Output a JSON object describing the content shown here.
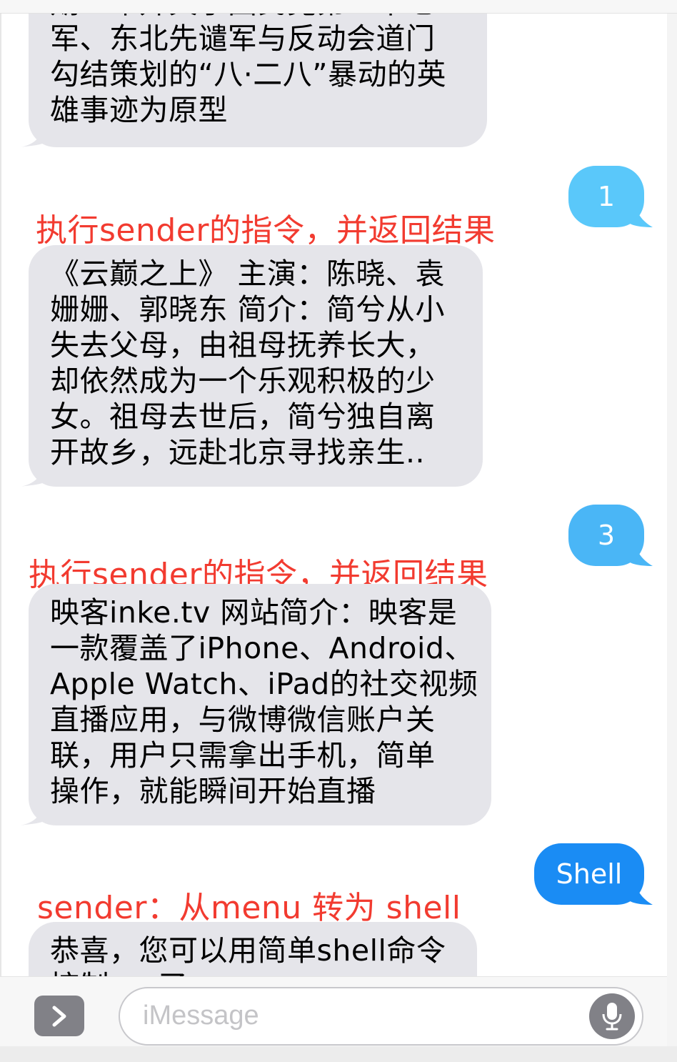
{
  "conversation": {
    "msg0": {
      "lines": [
        "期一年开关于国民党第二十七",
        "军、东北先谴军与反动会道门",
        "勾结策划的“八·二八”暴动的英",
        "雄事迹为原型"
      ]
    },
    "sent1": {
      "text": "1",
      "color": "#5ac8fa"
    },
    "annotation1": "执行sender的指令，并返回结果",
    "msg1": {
      "lines": [
        "《云巅之上》 主演：陈晓、袁",
        "姗姗、郭晓东 简介：简兮从小",
        "失去父母，由祖母抚养长大，",
        "却依然成为一个乐观积极的少",
        "女。祖母去世后，简兮独自离",
        "开故乡，远赴北京寻找亲生.."
      ]
    },
    "sent2": {
      "text": "3",
      "color": "#4ab6f6"
    },
    "annotation2": "执行sender的指令，并返回结果",
    "msg2": {
      "lines": [
        "映客inke.tv 网站简介：映客是",
        "一款覆盖了iPhone、Android、",
        "Apple Watch、iPad的社交视频",
        "直播应用，与微博微信账户关",
        "联，用户只需拿出手机，简单",
        "操作，就能瞬间开始直播"
      ]
    },
    "sent3": {
      "text": "Shell",
      "color": "#1a8cf4"
    },
    "annotation3": "sender：从menu 转为 shell",
    "msg3": {
      "lines": [
        "恭喜，您可以用简单shell命令",
        "控制 … 了"
      ]
    }
  },
  "composer": {
    "placeholder": "iMessage",
    "expand_icon": "chevron-right-icon",
    "mic_icon": "microphone-icon"
  },
  "colors": {
    "incoming_bubble": "#e5e5ea",
    "annotation": "#f23b30"
  }
}
